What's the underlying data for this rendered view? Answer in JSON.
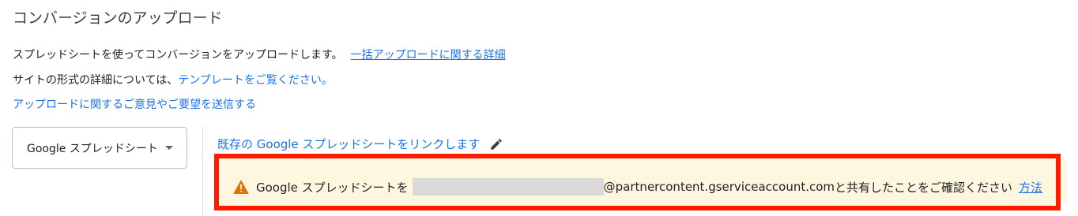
{
  "page": {
    "title": "コンバージョンのアップロード"
  },
  "intro": {
    "line1_text": "スプレッドシートを使ってコンバージョンをアップロードします。",
    "line1_link": "一括アップロードに関する詳細",
    "line2_text": "サイトの形式の詳細については、",
    "line2_link": "テンプレートをご覧ください。",
    "feedback_link": "アップロードに関するご意見やご要望を送信する"
  },
  "source_select": {
    "value": "Google スプレッドシート"
  },
  "link_sheet": {
    "label": "既存の Google スプレッドシートをリンクします"
  },
  "alert": {
    "prefix": "Google スプレッドシートを",
    "email_suffix": "@partnercontent.gserviceaccount.com",
    "suffix": " と共有したことをご確認ください",
    "how_link": "方法"
  },
  "colors": {
    "link": "#1a73e8",
    "highlight_border": "#ff1a00",
    "alert_bg": "#fef7e0",
    "warning": "#e37400"
  },
  "icons": {
    "edit": "pencil-icon",
    "warning": "warning-icon",
    "dropdown": "caret-down-icon"
  }
}
